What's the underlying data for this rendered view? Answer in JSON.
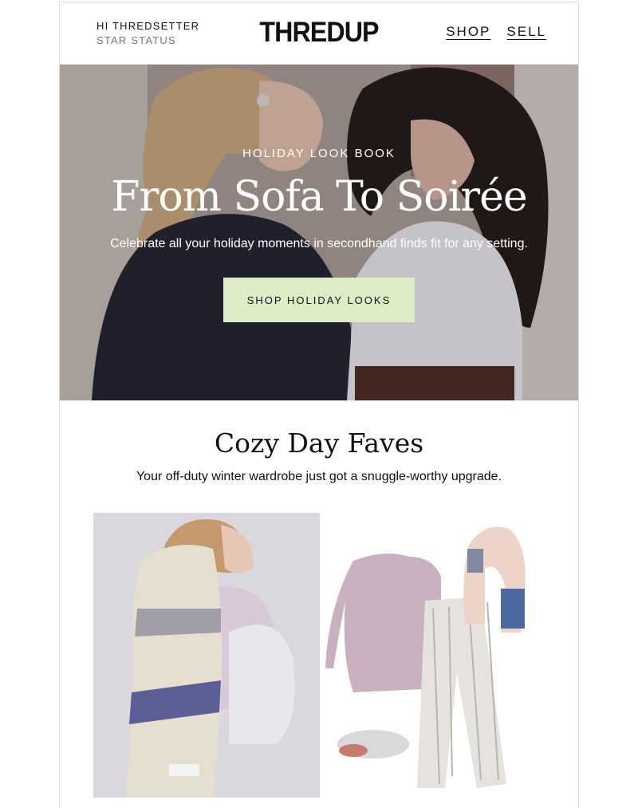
{
  "header": {
    "greeting": "HI THREDSETTER",
    "status": "STAR STATUS",
    "logo": "THREDUP",
    "nav": [
      {
        "label": "SHOP"
      },
      {
        "label": "SELL"
      }
    ]
  },
  "hero": {
    "eyebrow": "HOLIDAY LOOK BOOK",
    "title": "From Sofa To Soirée",
    "subtitle": "Celebrate all your holiday moments in secondhand finds fit for any setting.",
    "cta": "SHOP HOLIDAY LOOKS"
  },
  "section": {
    "title": "Cozy Day Faves",
    "subtitle": "Your off-duty winter wardrobe just got a snuggle-worthy upgrade."
  },
  "colors": {
    "cta_bg": "#dcedc8",
    "border": "#dcdcdc"
  }
}
